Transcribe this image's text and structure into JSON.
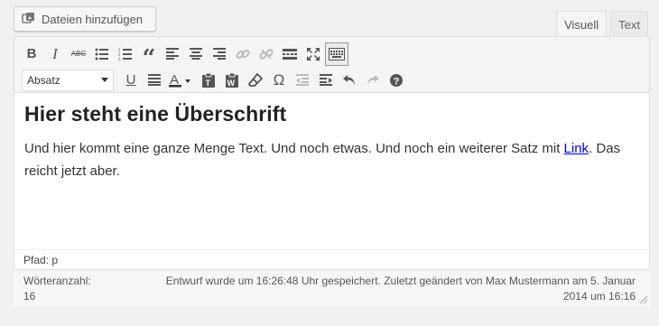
{
  "media_button": {
    "label": "Dateien hinzufügen",
    "icon": "add-media-icon"
  },
  "tabs": [
    {
      "label": "Visuell",
      "active": true
    },
    {
      "label": "Text",
      "active": false
    }
  ],
  "toolbar": {
    "row1": [
      "bold-icon",
      "italic-icon",
      "strikethrough-icon",
      "bullet-list-icon",
      "numbered-list-icon",
      "blockquote-icon",
      "align-left-icon",
      "align-center-icon",
      "align-right-icon",
      "link-icon",
      "unlink-icon",
      "read-more-icon",
      "fullscreen-icon",
      "toolbar-toggle-icon"
    ],
    "format_select": "Absatz",
    "row2": [
      "underline-icon",
      "justify-icon",
      "text-color-icon",
      "paste-text-icon",
      "paste-word-icon",
      "clear-format-icon",
      "special-char-icon",
      "outdent-icon",
      "indent-icon",
      "undo-icon",
      "redo-icon",
      "help-icon"
    ]
  },
  "content": {
    "heading": "Hier steht eine Überschrift",
    "para_before": "Und hier kommt eine ganze Menge Text. Und noch etwas. Und noch ein weiterer Satz mit ",
    "link_text": "Link",
    "para_after": ". Das reicht jetzt aber."
  },
  "path": "Pfad: p",
  "status": {
    "wordcount_label": "Wörteranzahl:",
    "wordcount_value": "16",
    "saved_line1": "Entwurf wurde um 16:26:48 Uhr gespeichert. Zuletzt geändert von Max Mustermann am 5. Januar",
    "saved_line2": "2014 um 16:16"
  },
  "colors": {
    "link": "#0000ee",
    "toolbar_bg": "#f5f5f5",
    "page_bg": "#f1f1f1"
  }
}
